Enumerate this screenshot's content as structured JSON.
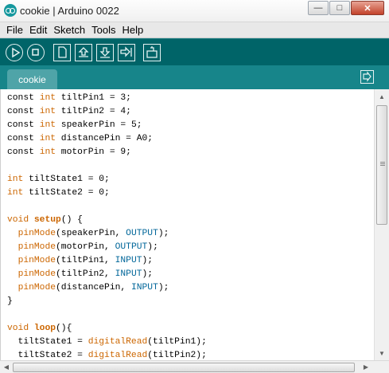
{
  "window": {
    "title": "cookie | Arduino 0022",
    "minimize_label": "—",
    "maximize_label": "□",
    "close_label": "✕"
  },
  "menu": {
    "items": [
      {
        "label": "File"
      },
      {
        "label": "Edit"
      },
      {
        "label": "Sketch"
      },
      {
        "label": "Tools"
      },
      {
        "label": "Help"
      }
    ]
  },
  "toolbar": {
    "buttons": [
      "verify",
      "stop",
      "new",
      "open",
      "save",
      "upload",
      "serial-monitor"
    ]
  },
  "tabs": [
    {
      "label": "cookie",
      "active": true
    }
  ],
  "colors": {
    "toolbar_bg": "#006468",
    "tabrow_bg": "#17858a",
    "tab_active_bg": "#4fa4a8",
    "keyword": "#cc6600",
    "constant": "#006699"
  },
  "code": {
    "lines": [
      [
        {
          "t": "const ",
          "c": "plain"
        },
        {
          "t": "int",
          "c": "type"
        },
        {
          "t": " tiltPin1 = 3;",
          "c": "plain"
        }
      ],
      [
        {
          "t": "const ",
          "c": "plain"
        },
        {
          "t": "int",
          "c": "type"
        },
        {
          "t": " tiltPin2 = 4;",
          "c": "plain"
        }
      ],
      [
        {
          "t": "const ",
          "c": "plain"
        },
        {
          "t": "int",
          "c": "type"
        },
        {
          "t": " speakerPin = 5;",
          "c": "plain"
        }
      ],
      [
        {
          "t": "const ",
          "c": "plain"
        },
        {
          "t": "int",
          "c": "type"
        },
        {
          "t": " distancePin = A0;",
          "c": "plain"
        }
      ],
      [
        {
          "t": "const ",
          "c": "plain"
        },
        {
          "t": "int",
          "c": "type"
        },
        {
          "t": " motorPin = 9;",
          "c": "plain"
        }
      ],
      [],
      [
        {
          "t": "int",
          "c": "type"
        },
        {
          "t": " tiltState1 = 0;",
          "c": "plain"
        }
      ],
      [
        {
          "t": "int",
          "c": "type"
        },
        {
          "t": " tiltState2 = 0;",
          "c": "plain"
        }
      ],
      [],
      [
        {
          "t": "void",
          "c": "type"
        },
        {
          "t": " ",
          "c": "plain"
        },
        {
          "t": "setup",
          "c": "func"
        },
        {
          "t": "() {",
          "c": "plain"
        }
      ],
      [
        {
          "t": "  ",
          "c": "plain"
        },
        {
          "t": "pinMode",
          "c": "call"
        },
        {
          "t": "(speakerPin, ",
          "c": "plain"
        },
        {
          "t": "OUTPUT",
          "c": "const"
        },
        {
          "t": ");",
          "c": "plain"
        }
      ],
      [
        {
          "t": "  ",
          "c": "plain"
        },
        {
          "t": "pinMode",
          "c": "call"
        },
        {
          "t": "(motorPin, ",
          "c": "plain"
        },
        {
          "t": "OUTPUT",
          "c": "const"
        },
        {
          "t": ");",
          "c": "plain"
        }
      ],
      [
        {
          "t": "  ",
          "c": "plain"
        },
        {
          "t": "pinMode",
          "c": "call"
        },
        {
          "t": "(tiltPin1, ",
          "c": "plain"
        },
        {
          "t": "INPUT",
          "c": "const"
        },
        {
          "t": ");",
          "c": "plain"
        }
      ],
      [
        {
          "t": "  ",
          "c": "plain"
        },
        {
          "t": "pinMode",
          "c": "call"
        },
        {
          "t": "(tiltPin2, ",
          "c": "plain"
        },
        {
          "t": "INPUT",
          "c": "const"
        },
        {
          "t": ");",
          "c": "plain"
        }
      ],
      [
        {
          "t": "  ",
          "c": "plain"
        },
        {
          "t": "pinMode",
          "c": "call"
        },
        {
          "t": "(distancePin, ",
          "c": "plain"
        },
        {
          "t": "INPUT",
          "c": "const"
        },
        {
          "t": ");",
          "c": "plain"
        }
      ],
      [
        {
          "t": "}",
          "c": "plain"
        }
      ],
      [],
      [
        {
          "t": "void",
          "c": "type"
        },
        {
          "t": " ",
          "c": "plain"
        },
        {
          "t": "loop",
          "c": "func"
        },
        {
          "t": "(){",
          "c": "plain"
        }
      ],
      [
        {
          "t": "  tiltState1 = ",
          "c": "plain"
        },
        {
          "t": "digitalRead",
          "c": "call"
        },
        {
          "t": "(tiltPin1);",
          "c": "plain"
        }
      ],
      [
        {
          "t": "  tiltState2 = ",
          "c": "plain"
        },
        {
          "t": "digitalRead",
          "c": "call"
        },
        {
          "t": "(tiltPin2);",
          "c": "plain"
        }
      ]
    ]
  },
  "scroll": {
    "vertical_fraction": 0.0,
    "up_arrow": "▲",
    "down_arrow": "▼",
    "left_arrow": "◀",
    "right_arrow": "▶"
  }
}
